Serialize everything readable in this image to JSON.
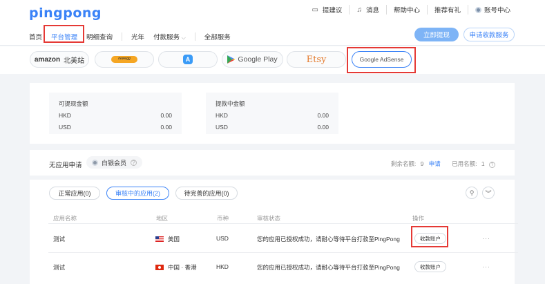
{
  "brand": {
    "logo": "pingpong"
  },
  "topbar": {
    "suggest": "提建议",
    "messages": "消息",
    "help": "帮助中心",
    "referral": "推荐有礼",
    "account": "账号中心"
  },
  "nav": {
    "home": "首页",
    "platform": "平台管理",
    "details": "明细查询",
    "guangnian": "光年",
    "payment": "付款服务",
    "all": "全部服务"
  },
  "actions": {
    "withdraw": "立即提现",
    "apply": "申请收款服务"
  },
  "platforms": {
    "amazon_word": "amazon",
    "amazon_region": "北美站",
    "newegg_word": "newegg",
    "googleplay": "Google Play",
    "etsy": "Etsy",
    "adsense": "Google AdSense"
  },
  "balances": {
    "available": {
      "title": "可提现金额",
      "rows": [
        {
          "cur": "HKD",
          "val": "0.00"
        },
        {
          "cur": "USD",
          "val": "0.00"
        }
      ]
    },
    "pending": {
      "title": "提款中金额",
      "rows": [
        {
          "cur": "HKD",
          "val": "0.00"
        },
        {
          "cur": "USD",
          "val": "0.00"
        }
      ]
    }
  },
  "apply": {
    "no_app": "无应用申请",
    "member": "白银会员",
    "quota_left_label": "剩余名额:",
    "quota_left": "9",
    "apply_link": "申请",
    "quota_used_label": "已用名额:",
    "quota_used": "1"
  },
  "tabs": {
    "normal": "正常应用(0)",
    "review": "审核中的应用(2)",
    "incomplete": "待完善的应用(0)"
  },
  "table": {
    "headers": {
      "name": "应用名称",
      "region": "地区",
      "currency": "币种",
      "status": "审核状态",
      "ops": "操作"
    },
    "rows": [
      {
        "name": "测试",
        "region": "美国",
        "currency": "USD",
        "status": "您的应用已授权成功，请耐心等待平台打款至PingPong",
        "op": "收款账户"
      },
      {
        "name": "测试",
        "region": "中国 · 香港",
        "currency": "HKD",
        "status": "您的应用已授权成功，请耐心等待平台打款至PingPong",
        "op": "收款账户"
      }
    ],
    "more": "···"
  },
  "colors": {
    "brand_blue": "#3a82f7",
    "highlight_red": "#e53935"
  }
}
